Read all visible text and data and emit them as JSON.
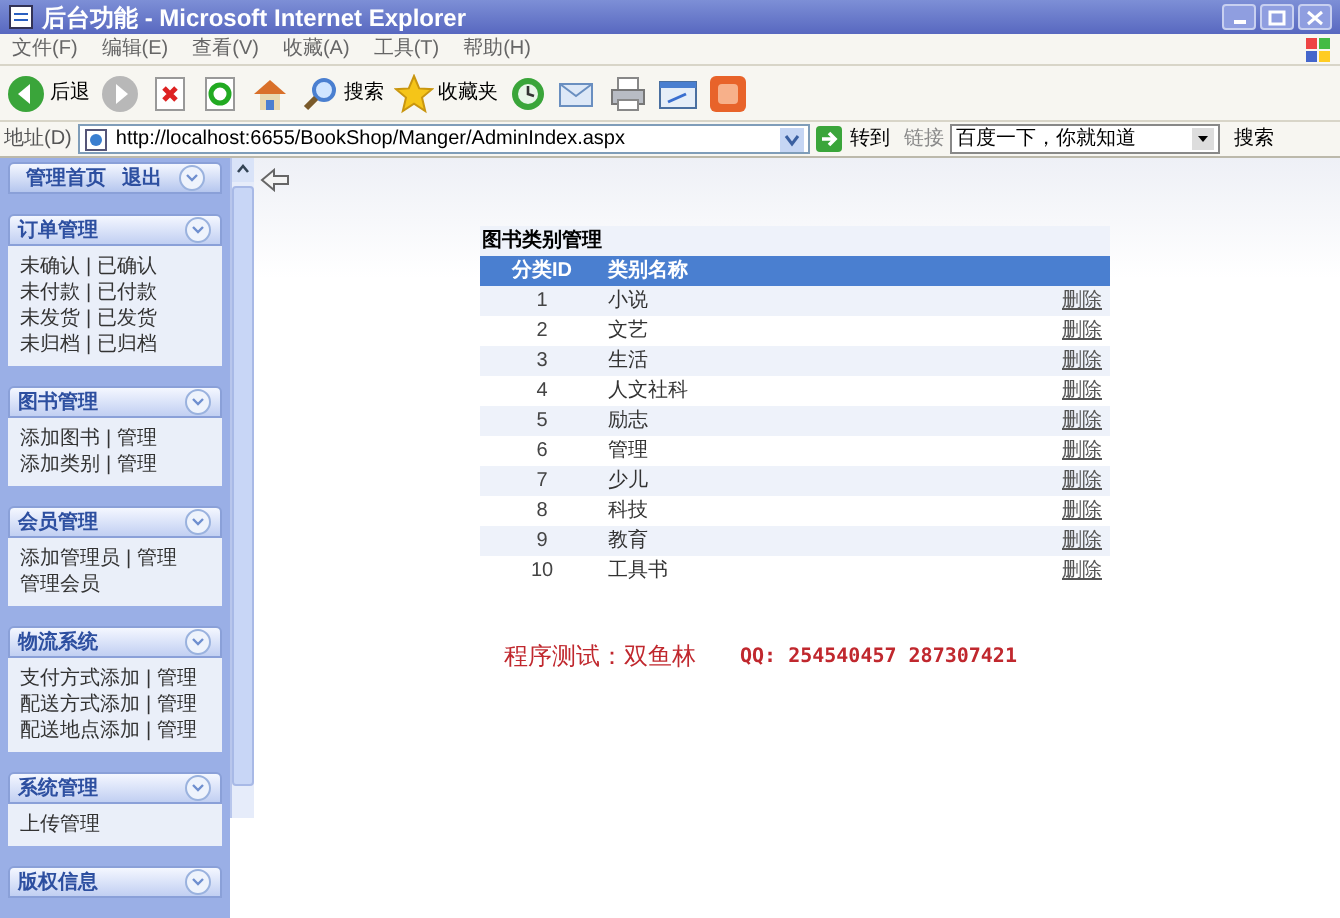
{
  "window": {
    "title": "后台功能 - Microsoft Internet Explorer"
  },
  "menu": [
    "文件(F)",
    "编辑(E)",
    "查看(V)",
    "收藏(A)",
    "工具(T)",
    "帮助(H)"
  ],
  "toolbar": [
    {
      "kind": "back",
      "label": "后退"
    },
    {
      "kind": "forward"
    },
    {
      "kind": "stop"
    },
    {
      "kind": "refresh"
    },
    {
      "kind": "home"
    },
    {
      "kind": "search",
      "label": "搜索"
    },
    {
      "kind": "favorites",
      "label": "收藏夹"
    },
    {
      "kind": "history"
    },
    {
      "kind": "mail"
    },
    {
      "kind": "print"
    },
    {
      "kind": "edit"
    },
    {
      "kind": "shop"
    }
  ],
  "address": {
    "label": "地址(D)",
    "value": "http://localhost:6655/BookShop/Manger/AdminIndex.aspx",
    "go": "转到",
    "links": "链接",
    "search_value": "百度一下，你就知道",
    "search_button": "搜索"
  },
  "sidebar": {
    "top_links": [
      "管理首页",
      "退出"
    ],
    "sections": [
      {
        "title": "订单管理",
        "separator": "|",
        "rows": [
          [
            "未确认",
            "已确认"
          ],
          [
            "未付款",
            "已付款"
          ],
          [
            "未发货",
            "已发货"
          ],
          [
            "未归档",
            "已归档"
          ]
        ]
      },
      {
        "title": "图书管理",
        "separator": "|",
        "rows": [
          [
            "添加图书",
            "管理"
          ],
          [
            "添加类别",
            "管理"
          ]
        ]
      },
      {
        "title": "会员管理",
        "separator": "|",
        "rows": [
          [
            "添加管理员",
            "管理"
          ],
          [
            "管理会员"
          ]
        ]
      },
      {
        "title": "物流系统",
        "separator": "|",
        "rows": [
          [
            "支付方式添加",
            "管理"
          ],
          [
            "配送方式添加",
            "管理"
          ],
          [
            "配送地点添加",
            "管理"
          ]
        ]
      },
      {
        "title": "系统管理",
        "rows": [
          [
            "上传管理"
          ]
        ]
      },
      {
        "title": "版权信息"
      }
    ]
  },
  "table": {
    "title": "图书类别管理",
    "columns": [
      "分类ID",
      "类别名称"
    ],
    "rows": [
      {
        "id": "1",
        "name": "小说",
        "action": "删除"
      },
      {
        "id": "2",
        "name": "文艺",
        "action": "删除"
      },
      {
        "id": "3",
        "name": "生活",
        "action": "删除"
      },
      {
        "id": "4",
        "name": "人文社科",
        "action": "删除"
      },
      {
        "id": "5",
        "name": "励志",
        "action": "删除"
      },
      {
        "id": "6",
        "name": "管理",
        "action": "删除"
      },
      {
        "id": "7",
        "name": "少儿",
        "action": "删除"
      },
      {
        "id": "8",
        "name": "科技",
        "action": "删除"
      },
      {
        "id": "9",
        "name": "教育",
        "action": "删除"
      },
      {
        "id": "10",
        "name": "工具书",
        "action": "删除"
      }
    ]
  },
  "footer": {
    "tester": "程序测试：双鱼林",
    "qq": "QQ: 254540457 287307421"
  }
}
